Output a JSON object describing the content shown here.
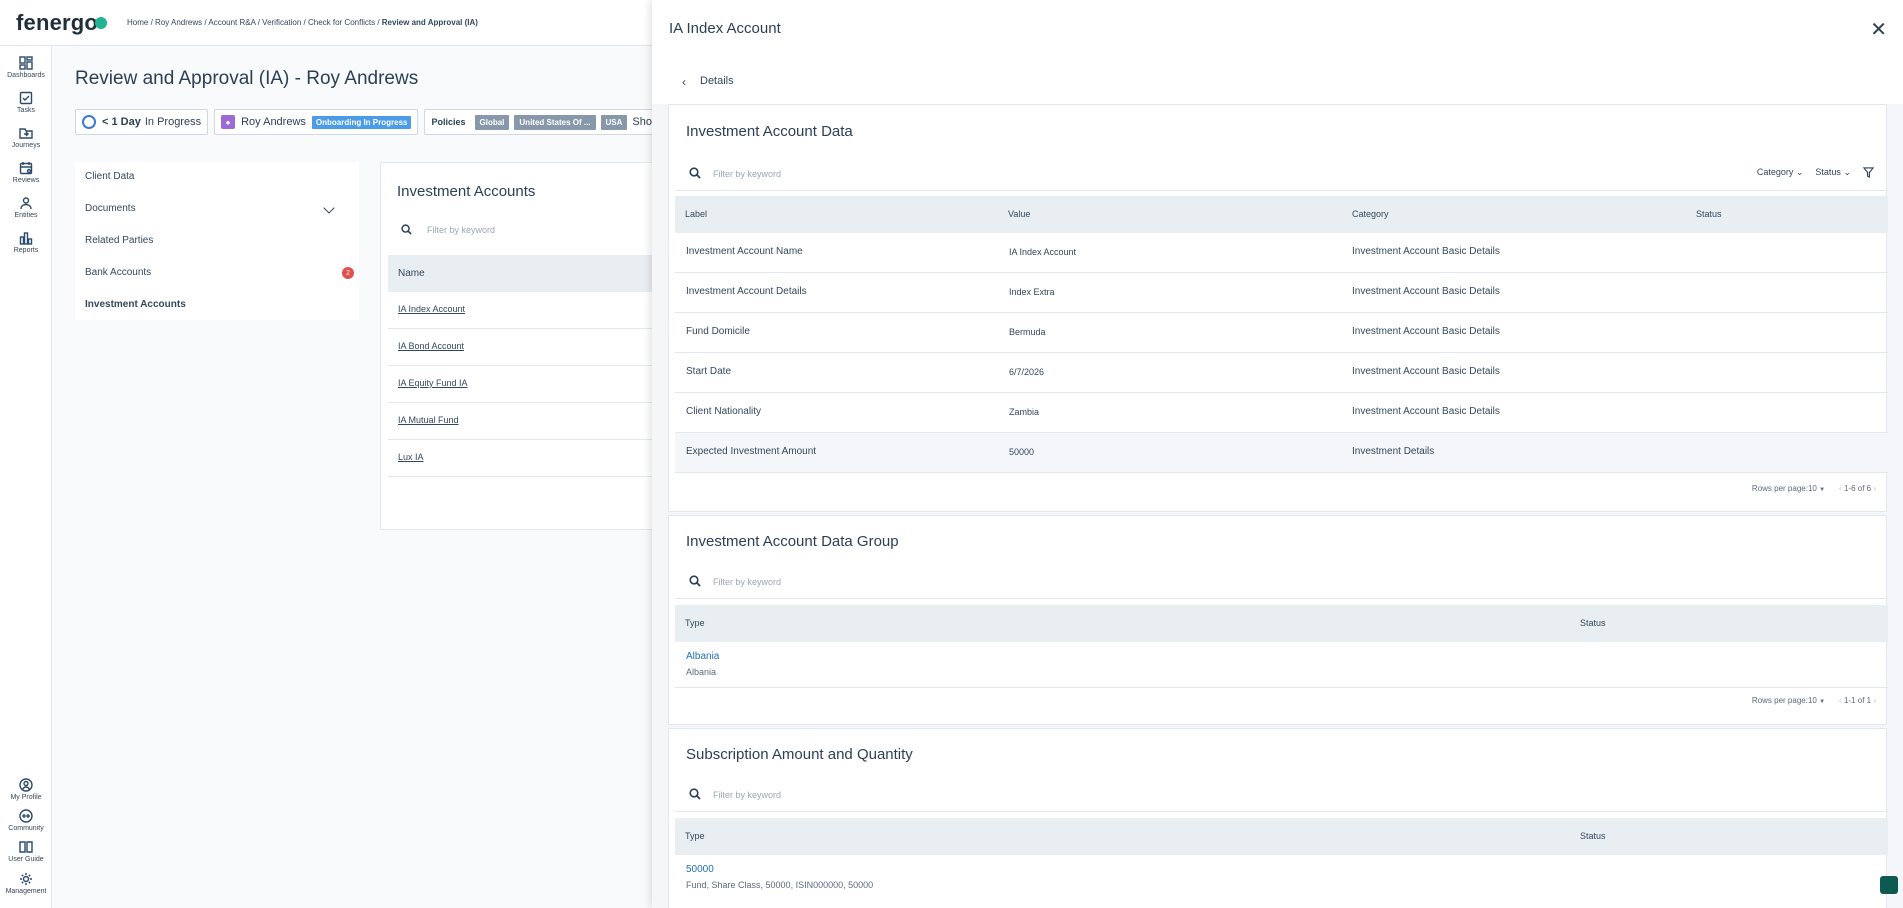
{
  "app": {
    "logo": "fenergo",
    "breadcrumb": {
      "trail": "Home / Roy Andrews / Account R&A / Verification / Check for Conflicts / ",
      "current": "Review and Approval (IA)"
    }
  },
  "nav": {
    "top": [
      {
        "label": "Dashboards",
        "icon": "dashboard-icon"
      },
      {
        "label": "Tasks",
        "icon": "tasks-icon"
      },
      {
        "label": "Journeys",
        "icon": "journeys-icon"
      },
      {
        "label": "Reviews",
        "icon": "reviews-icon"
      },
      {
        "label": "Entities",
        "icon": "entities-icon"
      },
      {
        "label": "Reports",
        "icon": "reports-icon"
      }
    ],
    "bottom": [
      {
        "label": "My Profile",
        "icon": "profile-icon"
      },
      {
        "label": "Community",
        "icon": "community-icon"
      },
      {
        "label": "User Guide",
        "icon": "user-guide-icon"
      },
      {
        "label": "Management",
        "icon": "management-icon"
      }
    ]
  },
  "page": {
    "title": "Review and Approval (IA) - Roy Andrews",
    "chips": {
      "sla": "< 1 Day",
      "status": "In Progress",
      "entity": "Roy Andrews",
      "entity_badge": "Onboarding In Progress",
      "policies_label": "Policies",
      "policy_badges": [
        "Global",
        "United States Of ...",
        "USA"
      ],
      "overflow": "Sho"
    }
  },
  "left_panel": {
    "items": [
      "Client Data",
      "Documents",
      "Related Parties",
      "Bank Accounts",
      "Investment Accounts"
    ],
    "bank_accounts_count": "2"
  },
  "inv_panel": {
    "title": "Investment Accounts",
    "search_placeholder": "Filter by keyword",
    "column": "Name",
    "rows": [
      "IA Index Account",
      "IA Bond Account",
      "IA Equity Fund IA",
      "IA Mutual Fund",
      "Lux IA"
    ]
  },
  "drawer": {
    "title": "IA Index Account",
    "back_label": "Details",
    "cards": {
      "data": {
        "title": "Investment Account Data",
        "search_placeholder": "Filter by keyword",
        "filter_category": "Category",
        "filter_status": "Status",
        "columns": [
          "Label",
          "Value",
          "Category",
          "Status"
        ],
        "rows": [
          [
            "Investment Account Name",
            "IA Index Account",
            "Investment Account Basic Details",
            ""
          ],
          [
            "Investment Account Details",
            "Index Extra",
            "Investment Account Basic Details",
            ""
          ],
          [
            "Fund Domicile",
            "Bermuda",
            "Investment Account Basic Details",
            ""
          ],
          [
            "Start Date",
            "6/7/2026",
            "Investment Account Basic Details",
            ""
          ],
          [
            "Client Nationality",
            "Zambia",
            "Investment Account Basic Details",
            ""
          ],
          [
            "Expected Investment Amount",
            "50000",
            "Investment Details",
            ""
          ]
        ],
        "rows_per_page": "Rows per page:10",
        "range": "1-6 of 6"
      },
      "group": {
        "title": "Investment Account Data Group",
        "search_placeholder": "Filter by keyword",
        "columns": [
          "Type",
          "Status"
        ],
        "row_link": "Albania",
        "row_sub": "Albania",
        "rows_per_page": "Rows per page:10",
        "range": "1-1 of 1"
      },
      "subscription": {
        "title": "Subscription Amount and Quantity",
        "search_placeholder": "Filter by keyword",
        "columns": [
          "Type",
          "Status"
        ],
        "row_link": "50000",
        "row_sub": "Fund, Share Class, 50000, ISIN000000, 50000"
      }
    }
  }
}
